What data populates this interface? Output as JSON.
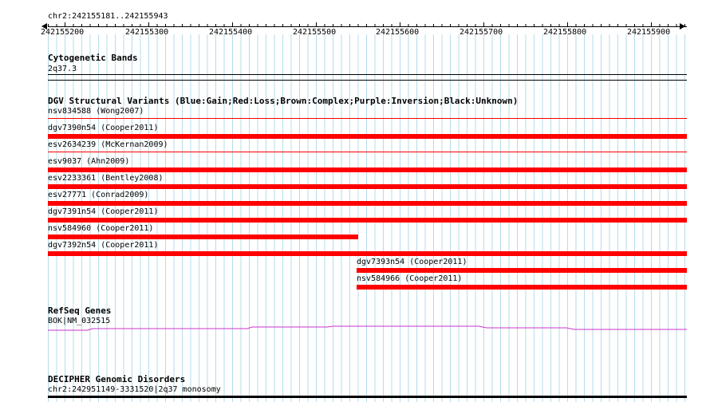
{
  "ruler": {
    "location": "chr2:242155181..242155943",
    "ticks": [
      "242155200",
      "242155300",
      "242155400",
      "242155500",
      "242155600",
      "242155700",
      "242155800",
      "242155900"
    ]
  },
  "tracks": {
    "cytoband": {
      "title": "Cytogenetic Bands",
      "feature": "2q37.3"
    },
    "dgv": {
      "title": "DGV Structural Variants (Blue:Gain;Red:Loss;Brown:Complex;Purple:Inversion;Black:Unknown)",
      "features": [
        "nsv834588 (Wong2007)",
        "dgv7390n54 (Cooper2011)",
        "esv2634239 (McKernan2009)",
        "esv9037 (Ahn2009)",
        "esv2233361 (Bentley2008)",
        "esv27771 (Conrad2009)",
        "dgv7391n54 (Cooper2011)",
        "nsv584960 (Cooper2011)",
        "dgv7392n54 (Cooper2011)",
        "dgv7393n54 (Cooper2011)",
        "nsv584966 (Cooper2011)"
      ]
    },
    "refseq": {
      "title": "RefSeq Genes",
      "feature": "BOK|NM_032515"
    },
    "decipher": {
      "title": "DECIPHER Genomic Disorders",
      "feature": "chr2:242951149-3331520|2q37 monosomy"
    }
  },
  "colors": {
    "loss": "#ff0000",
    "gene": "#cc33cc",
    "grid": "#b6dcea",
    "line": "#000000"
  }
}
